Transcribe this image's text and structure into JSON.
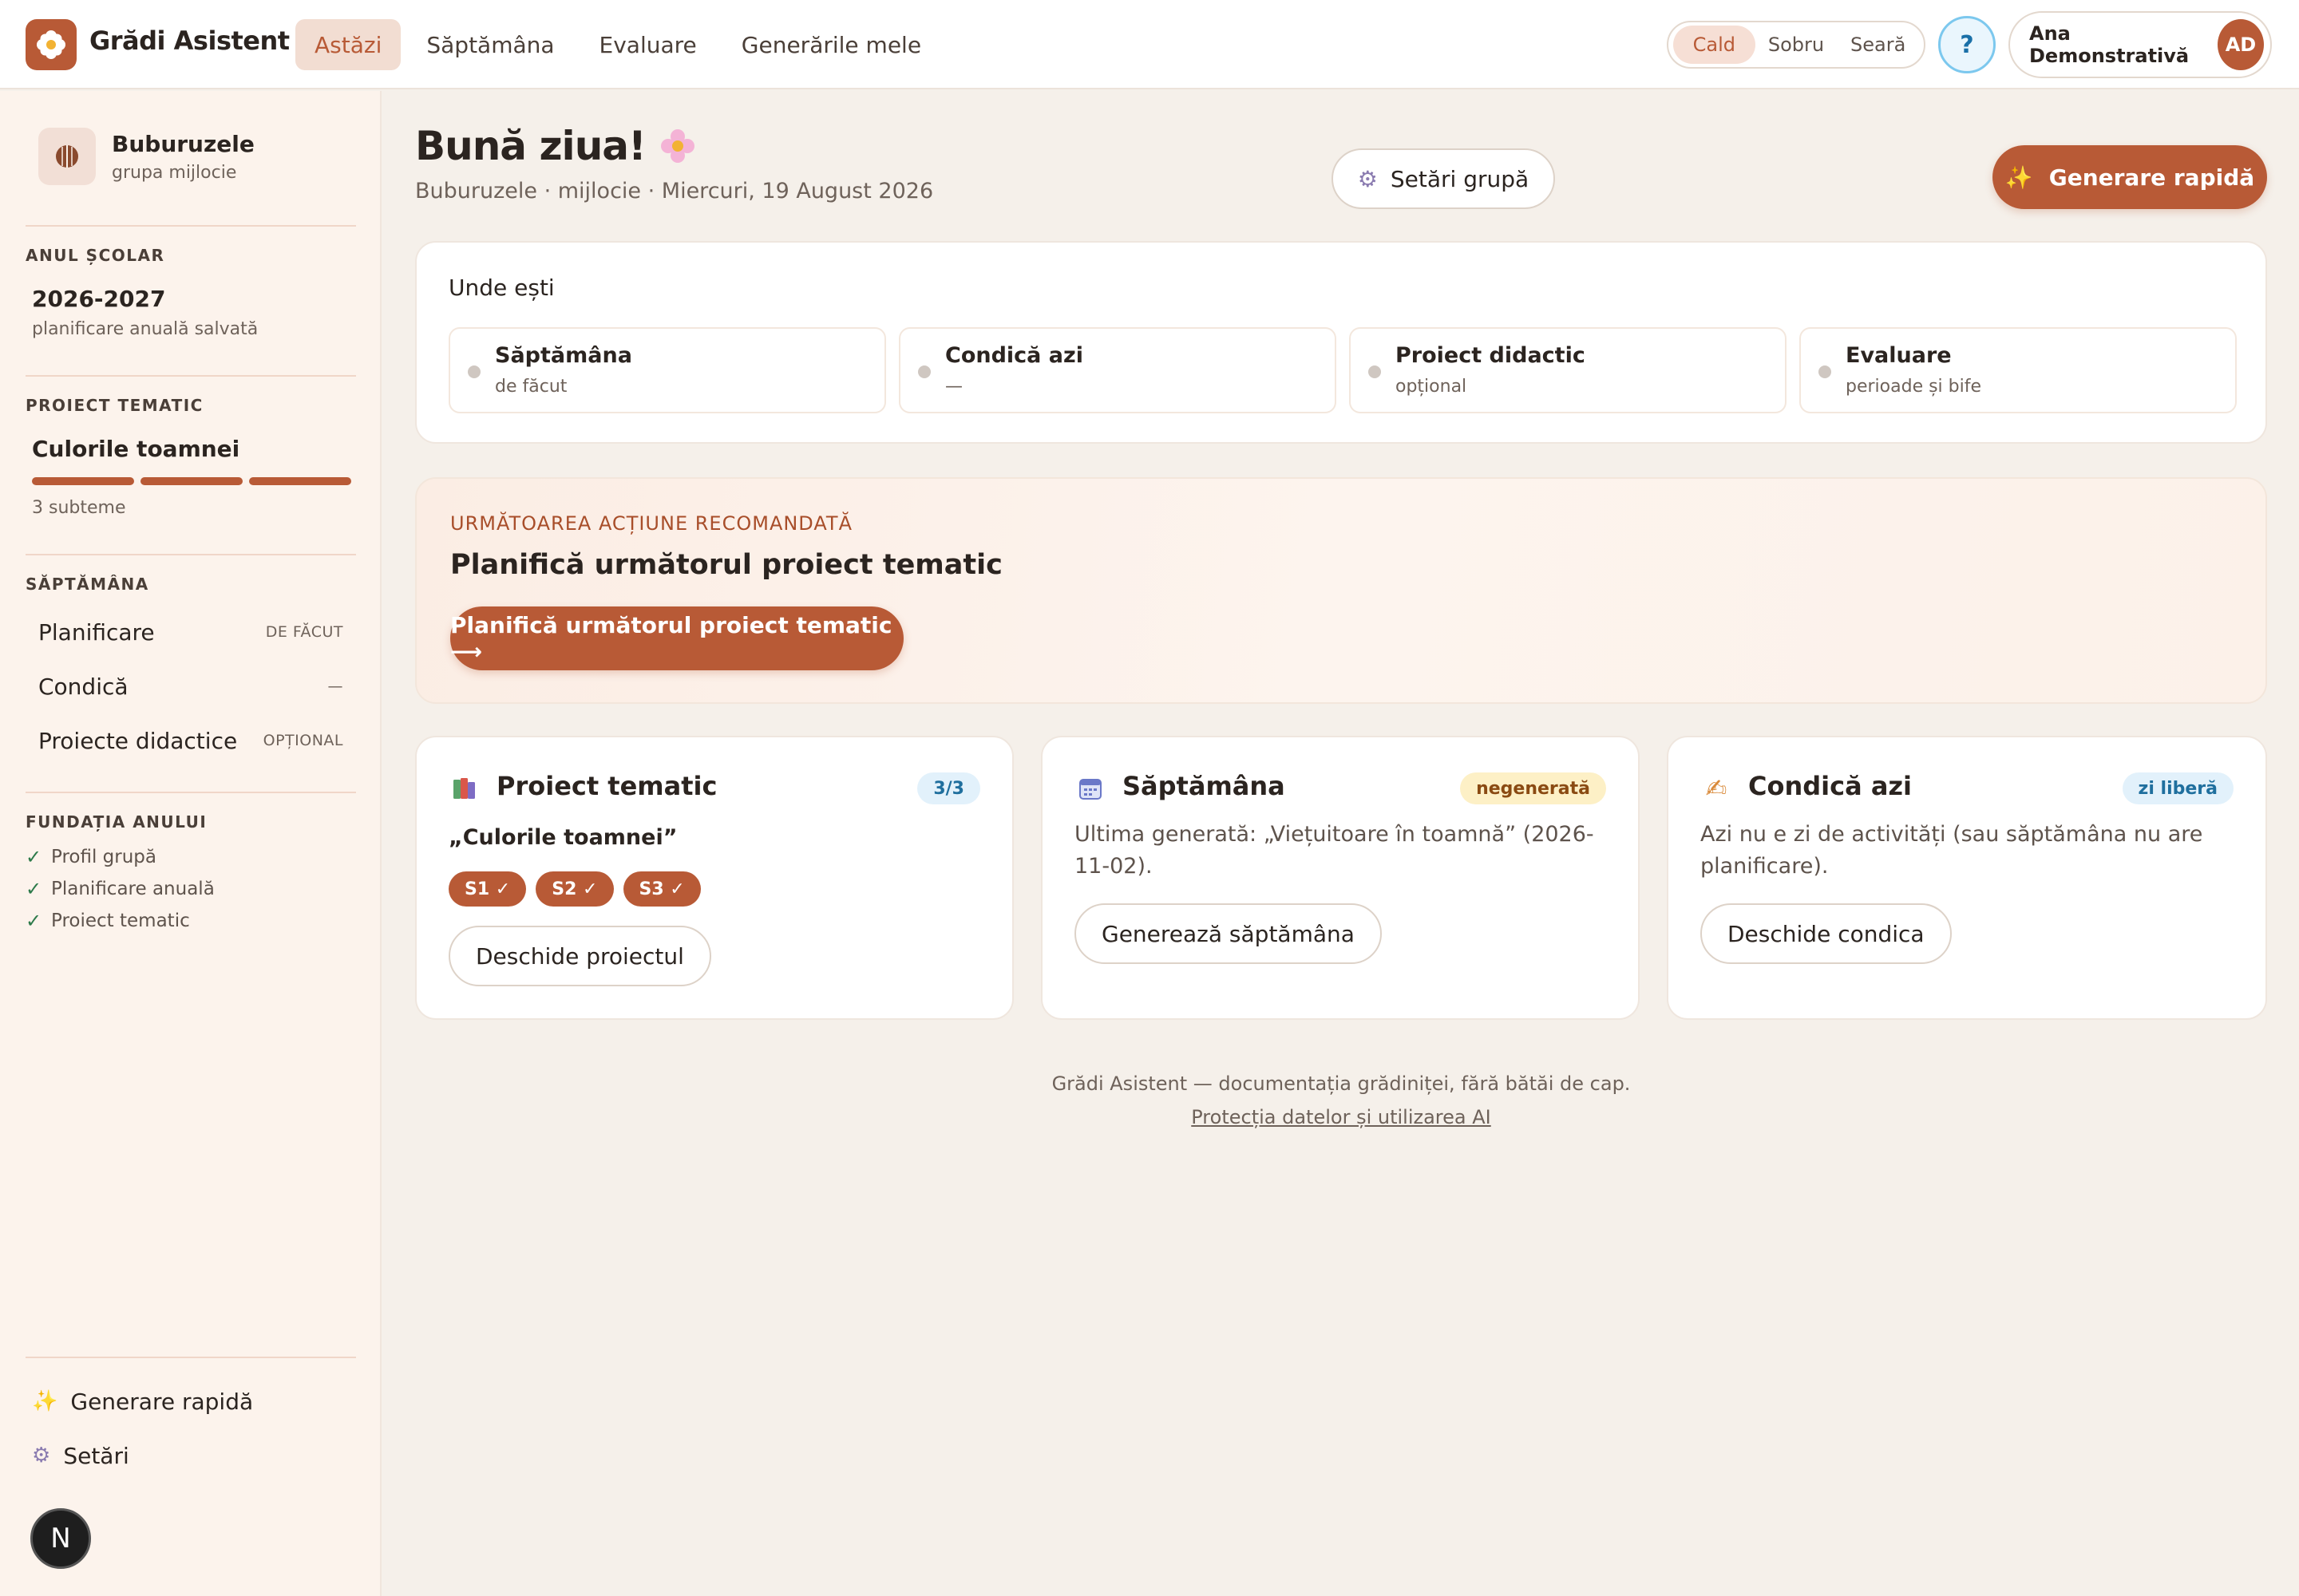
{
  "app": {
    "title": "Grădi Asistent",
    "logo_icon": "flower-icon"
  },
  "nav": {
    "items": [
      {
        "label": "Astăzi",
        "active": true
      },
      {
        "label": "Săptămâna",
        "active": false
      },
      {
        "label": "Evaluare",
        "active": false
      },
      {
        "label": "Generările mele",
        "active": false
      }
    ]
  },
  "theme": {
    "options": [
      "Cald",
      "Sobru",
      "Seară"
    ],
    "selected": "Cald"
  },
  "help": {
    "label": "?"
  },
  "user": {
    "name": "Ana Demonstrativă",
    "initials": "AD"
  },
  "sidebar": {
    "group": {
      "name": "Buburuzele",
      "subtitle": "grupa mijlocie",
      "icon": "ladybug-icon"
    },
    "school_year": {
      "heading": "ANUL ȘCOLAR",
      "value": "2026-2027",
      "note": "planificare anuală salvată"
    },
    "project": {
      "heading": "PROIECT TEMATIC",
      "name": "Culorile toamnei",
      "subthemes": "3 subteme",
      "progress_segments": 3
    },
    "week": {
      "heading": "SĂPTĂMÂNA",
      "items": [
        {
          "label": "Planificare",
          "status": "DE FĂCUT"
        },
        {
          "label": "Condică",
          "status": "—"
        },
        {
          "label": "Proiecte didactice",
          "status": "OPȚIONAL"
        }
      ]
    },
    "foundation": {
      "heading": "FUNDAȚIA ANULUI",
      "items": [
        "Profil grupă",
        "Planificare anuală",
        "Proiect tematic"
      ]
    },
    "bottom": {
      "quick_gen": {
        "label": "Generare rapidă",
        "icon": "sparkles-icon"
      },
      "settings": {
        "label": "Setări",
        "icon": "gear-icon"
      }
    },
    "n_badge": "N"
  },
  "main": {
    "greeting": "Bună ziua!",
    "greeting_icon": "flower-emoji-icon",
    "subtitle": "Buburuzele · mijlocie · Miercuri, 19 August 2026",
    "group_settings_button": "Setări grupă",
    "quick_gen_button": "Generare rapidă",
    "where": {
      "title": "Unde ești",
      "steps": [
        {
          "title": "Săptămâna",
          "sub": "de făcut"
        },
        {
          "title": "Condică azi",
          "sub": "—"
        },
        {
          "title": "Proiect didactic",
          "sub": "opțional"
        },
        {
          "title": "Evaluare",
          "sub": "perioade și bife"
        }
      ]
    },
    "recommendation": {
      "label": "URMĂTOAREA ACȚIUNE RECOMANDATĂ",
      "title": "Planifică următorul proiect tematic",
      "button": "Planifică următorul proiect tematic ⟶"
    },
    "cards": {
      "project": {
        "title": "Proiect tematic",
        "badge": "3/3",
        "quote": "„Culorile toamnei”",
        "chips": [
          "S1 ✓",
          "S2 ✓",
          "S3 ✓"
        ],
        "button": "Deschide proiectul"
      },
      "week": {
        "title": "Săptămâna",
        "badge": "negenerată",
        "text": "Ultima generată: „Viețuitoare în toamnă” (2026-11-02).",
        "button": "Generează săptămâna"
      },
      "today": {
        "title": "Condică azi",
        "badge": "zi liberă",
        "text": "Azi nu e zi de activități (sau săptămâna nu are planificare).",
        "button": "Deschide condica"
      }
    },
    "footer": {
      "tagline": "Grădi Asistent — documentația grădiniței, fără bătăi de cap.",
      "privacy_link": "Protecția datelor și utilizarea AI"
    }
  },
  "colors": {
    "accent": "#b85a36",
    "sidebar_bg": "#fcf3ec",
    "page_bg": "#f5f0ea"
  }
}
